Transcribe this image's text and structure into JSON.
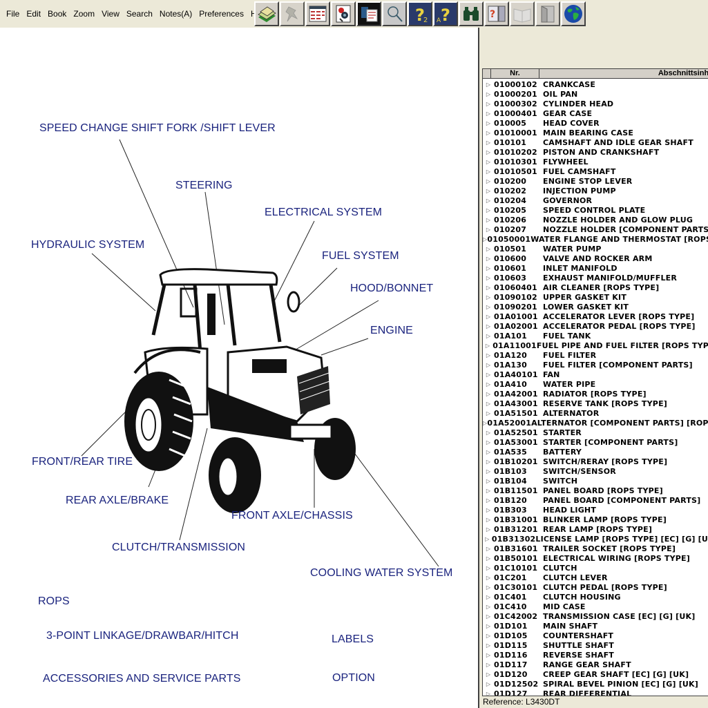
{
  "menu": [
    "File",
    "Edit",
    "Book",
    "Zoom",
    "View",
    "Search",
    "Notes(A)",
    "Preferences",
    "Help"
  ],
  "toolbar": [
    {
      "icon": "card-file-icon",
      "enabled": true
    },
    {
      "icon": "pushpin-icon",
      "enabled": false
    },
    {
      "icon": "parts-list-icon",
      "enabled": true
    },
    {
      "icon": "illustrated-parts-icon",
      "enabled": true
    },
    {
      "icon": "parts-sheet-icon",
      "enabled": true
    },
    {
      "icon": "magnifier-icon",
      "enabled": true
    },
    {
      "icon": "help-question-icon",
      "enabled": true
    },
    {
      "icon": "help-question-alt-icon",
      "enabled": true
    },
    {
      "icon": "binoculars-icon",
      "enabled": true
    },
    {
      "icon": "document-help-icon",
      "enabled": true
    },
    {
      "icon": "open-book-icon",
      "enabled": false
    },
    {
      "icon": "door-icon",
      "enabled": false
    },
    {
      "icon": "globe-icon",
      "enabled": true
    }
  ],
  "diagram": {
    "callouts": [
      "SPEED CHANGE SHIFT FORK /SHIFT LEVER",
      "STEERING",
      "ELECTRICAL SYSTEM",
      "HYDRAULIC SYSTEM",
      "FUEL SYSTEM",
      "HOOD/BONNET",
      "ENGINE",
      "FRONT/REAR TIRE",
      "REAR AXLE/BRAKE",
      "FRONT AXLE/CHASSIS",
      "CLUTCH/TRANSMISSION",
      "COOLING WATER SYSTEM",
      "ROPS",
      "3-POINT LINKAGE/DRAWBAR/HITCH",
      "LABELS",
      "ACCESSORIES AND SERVICE PARTS",
      "OPTION"
    ],
    "label_color": "#1a237e"
  },
  "grid": {
    "headers": {
      "nr": "Nr.",
      "desc": "Abschnittsinhalt"
    },
    "rows": [
      [
        "01000102",
        "CRANKCASE"
      ],
      [
        "01000201",
        "OIL PAN"
      ],
      [
        "01000302",
        "CYLINDER HEAD"
      ],
      [
        "01000401",
        "GEAR CASE"
      ],
      [
        "010005",
        "HEAD COVER"
      ],
      [
        "01010001",
        "MAIN BEARING CASE"
      ],
      [
        "010101",
        "CAMSHAFT AND IDLE GEAR SHAFT"
      ],
      [
        "01010202",
        "PISTON AND CRANKSHAFT"
      ],
      [
        "01010301",
        "FLYWHEEL"
      ],
      [
        "01010501",
        "FUEL CAMSHAFT"
      ],
      [
        "010200",
        "ENGINE STOP LEVER"
      ],
      [
        "010202",
        "INJECTION PUMP"
      ],
      [
        "010204",
        "GOVERNOR"
      ],
      [
        "010205",
        "SPEED CONTROL PLATE"
      ],
      [
        "010206",
        "NOZZLE HOLDER AND GLOW PLUG"
      ],
      [
        "010207",
        "NOZZLE HOLDER  [COMPONENT PARTS]"
      ],
      [
        "01050001",
        "WATER FLANGE AND THERMOSTAT [ROPS TYPE]"
      ],
      [
        "010501",
        "WATER PUMP"
      ],
      [
        "010600",
        "VALVE AND ROCKER ARM"
      ],
      [
        "010601",
        "INLET MANIFOLD"
      ],
      [
        "010603",
        "EXHAUST MANIFOLD/MUFFLER"
      ],
      [
        "01060401",
        "AIR CLEANER [ROPS TYPE]"
      ],
      [
        "01090102",
        "UPPER GASKET KIT"
      ],
      [
        "01090201",
        "LOWER GASKET KIT"
      ],
      [
        "01A01001",
        "ACCELERATOR LEVER [ROPS TYPE]"
      ],
      [
        "01A02001",
        "ACCELERATOR PEDAL [ROPS TYPE]"
      ],
      [
        "01A101",
        "FUEL TANK"
      ],
      [
        "01A11001",
        "FUEL PIPE AND FUEL FILTER [ROPS TYPE]"
      ],
      [
        "01A120",
        "FUEL FILTER"
      ],
      [
        "01A130",
        "FUEL FILTER [COMPONENT PARTS]"
      ],
      [
        "01A40101",
        "FAN"
      ],
      [
        "01A410",
        "WATER PIPE"
      ],
      [
        "01A42001",
        "RADIATOR [ROPS TYPE]"
      ],
      [
        "01A43001",
        "RESERVE TANK [ROPS TYPE]"
      ],
      [
        "01A51501",
        "ALTERNATOR"
      ],
      [
        "01A52001",
        "ALTERNATOR [COMPONENT PARTS] [ROPS TYPE]"
      ],
      [
        "01A52501",
        "STARTER"
      ],
      [
        "01A53001",
        "STARTER [COMPONENT PARTS]"
      ],
      [
        "01A535",
        "BATTERY"
      ],
      [
        "01B10201",
        "SWITCH/RERAY [ROPS TYPE]"
      ],
      [
        "01B103",
        "SWITCH/SENSOR"
      ],
      [
        "01B104",
        "SWITCH"
      ],
      [
        "01B11501",
        "PANEL BOARD [ROPS TYPE]"
      ],
      [
        "01B120",
        "PANEL BOARD [COMPONENT PARTS]"
      ],
      [
        "01B303",
        "HEAD LIGHT"
      ],
      [
        "01B31001",
        "BLINKER LAMP [ROPS TYPE]"
      ],
      [
        "01B31201",
        "REAR LAMP [ROPS TYPE]"
      ],
      [
        "01B31302",
        "LICENSE LAMP [ROPS TYPE] [EC] [G] [UK]"
      ],
      [
        "01B31601",
        "TRAILER SOCKET [ROPS TYPE]"
      ],
      [
        "01B50101",
        "ELECTRICAL WIRING [ROPS TYPE]"
      ],
      [
        "01C10101",
        "CLUTCH"
      ],
      [
        "01C201",
        "CLUTCH LEVER"
      ],
      [
        "01C30101",
        "CLUTCH PEDAL [ROPS TYPE]"
      ],
      [
        "01C401",
        "CLUTCH HOUSING"
      ],
      [
        "01C410",
        "MID CASE"
      ],
      [
        "01C42002",
        "TRANSMISSION CASE [EC] [G] [UK]"
      ],
      [
        "01D101",
        "MAIN SHAFT"
      ],
      [
        "01D105",
        "COUNTERSHAFT"
      ],
      [
        "01D115",
        "SHUTTLE SHAFT"
      ],
      [
        "01D116",
        "REVERSE SHAFT"
      ],
      [
        "01D117",
        "RANGE GEAR SHAFT"
      ],
      [
        "01D120",
        "CREEP GEAR SHAFT [EC] [G] [UK]"
      ],
      [
        "01D12502",
        "SPIRAL BEVEL PINION [EC] [G] [UK]"
      ],
      [
        "01D127",
        "REAR DIFFERENTIAL"
      ]
    ]
  },
  "status": {
    "reference": "Reference: L3430DT"
  }
}
